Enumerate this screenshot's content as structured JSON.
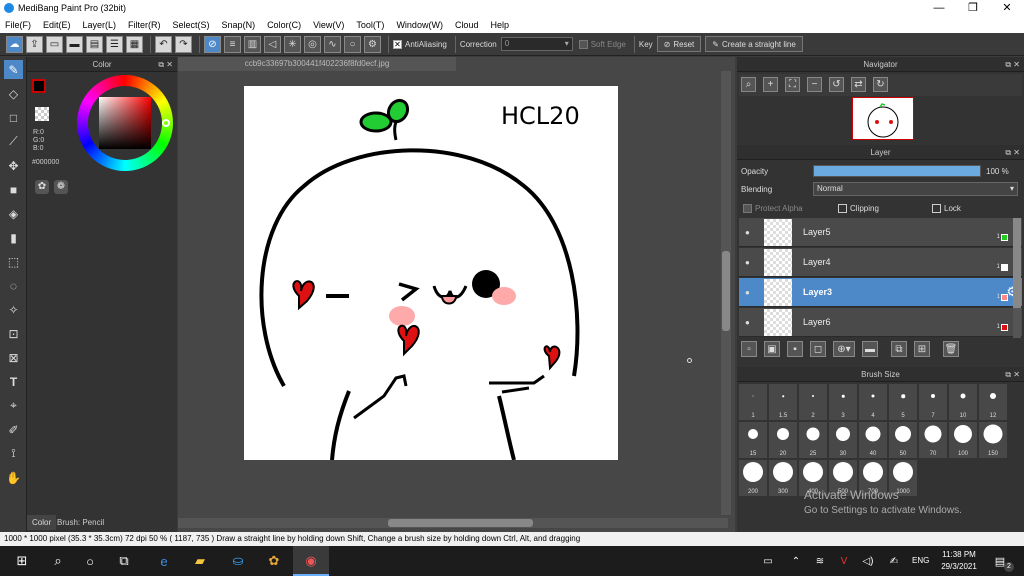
{
  "window": {
    "title": "MediBang Paint Pro (32bit)",
    "minimize": "—",
    "maximize": "❐",
    "close": "✕"
  },
  "menu": [
    "File(F)",
    "Edit(E)",
    "Layer(L)",
    "Filter(R)",
    "Select(S)",
    "Snap(N)",
    "Color(C)",
    "View(V)",
    "Tool(T)",
    "Window(W)",
    "Cloud",
    "Help"
  ],
  "toolbar": {
    "antialiasing_label": "AntiAliasing",
    "correction_label": "Correction",
    "correction_value": "0",
    "soft_edge_label": "Soft Edge",
    "key_label": "Key",
    "reset_label": "Reset",
    "straight_line_label": "Create a straight line"
  },
  "color_panel": {
    "title": "Color",
    "rgb_r": "R:0",
    "rgb_g": "G:0",
    "rgb_b": "B:0",
    "hex": "#000000",
    "foreground": "#000000",
    "bottom_tab_color": "Color",
    "bottom_tab_brush": "Brush: Pencil"
  },
  "document": {
    "filename": "ccb9c33697b300441f402236f8fd0ecf.jpg",
    "drawing_text": "HCL20"
  },
  "navigator": {
    "title": "Navigator"
  },
  "layer_panel": {
    "title": "Layer",
    "opacity_label": "Opacity",
    "opacity_value": "100 %",
    "opacity_fraction": 1.0,
    "blending_label": "Blending",
    "blending_value": "Normal",
    "protect_alpha": "Protect Alpha",
    "clipping": "Clipping",
    "lock": "Lock",
    "layers": [
      {
        "name": "Layer5",
        "num": "1",
        "color": "#22cc22"
      },
      {
        "name": "Layer4",
        "num": "1",
        "color": "#ffffff"
      },
      {
        "name": "Layer3",
        "num": "1",
        "color": "#ff8888"
      },
      {
        "name": "Layer6",
        "num": "1",
        "color": "#dd1111"
      }
    ]
  },
  "brush_panel": {
    "title": "Brush Size",
    "sizes": [
      "1",
      "1.5",
      "2",
      "3",
      "4",
      "5",
      "7",
      "10",
      "12",
      "15",
      "20",
      "25",
      "30",
      "40",
      "50",
      "70",
      "100",
      "150",
      "200",
      "300",
      "400",
      "500",
      "700",
      "1000"
    ]
  },
  "status": {
    "text": "1000 * 1000 pixel  (35.3 * 35.3cm)  72 dpi  50 %  ( 1187, 735 )  Draw a straight line by holding down Shift, Change a brush size by holding down Ctrl, Alt, and dragging"
  },
  "watermark": {
    "line1": "Activate Windows",
    "line2": "Go to Settings to activate Windows."
  },
  "taskbar": {
    "lang": "ENG",
    "time": "11:38 PM",
    "date": "29/3/2021",
    "notif_count": "2"
  }
}
